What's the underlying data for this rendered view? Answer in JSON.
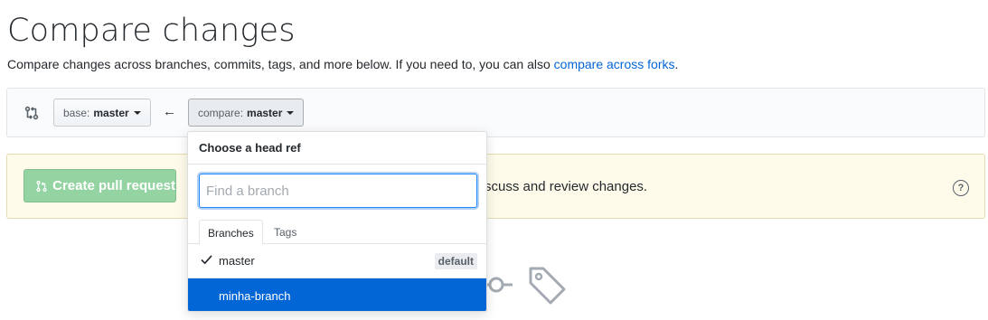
{
  "page": {
    "title": "Compare changes",
    "subtitle": "Compare changes across branches, commits, tags, and more below. If you need to, you can also ",
    "subtitle_link": "compare across forks",
    "subtitle_end": "."
  },
  "range": {
    "base_label": "base:",
    "base_value": "master",
    "compare_label": "compare:",
    "compare_value": "master",
    "arrow": "←"
  },
  "notice": {
    "create_pr_label": "Create pull request",
    "text": "scuss and review changes.",
    "help": "?"
  },
  "dropdown": {
    "header": "Choose a head ref",
    "search_placeholder": "Find a branch",
    "tabs": [
      {
        "label": "Branches",
        "active": true
      },
      {
        "label": "Tags",
        "active": false
      }
    ],
    "items": [
      {
        "name": "master",
        "checked": true,
        "badge": "default"
      },
      {
        "name": "minha-branch",
        "selected": true
      }
    ]
  },
  "colors": {
    "link": "#0366d6",
    "selected": "#0366d6",
    "create_pr": "#94d3a2",
    "notice_bg": "#fffbea"
  },
  "icons": [
    "git-compare-icon",
    "arrow-left-icon",
    "git-pull-request-icon",
    "question-icon",
    "check-icon",
    "git-commit-icon",
    "tag-icon"
  ]
}
